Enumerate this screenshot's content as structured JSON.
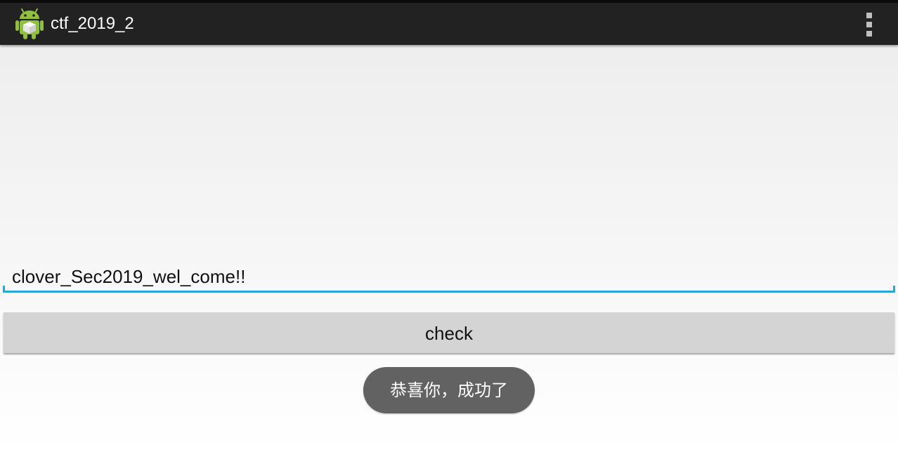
{
  "action_bar": {
    "title": "ctf_2019_2",
    "app_icon": "android-robot-icon",
    "overflow_icon": "overflow-menu-icon"
  },
  "input": {
    "value": "clover_Sec2019_wel_come!!",
    "accent_color": "#2aa6d6"
  },
  "check_button": {
    "label": "check"
  },
  "toast": {
    "message": "恭喜你，成功了"
  },
  "colors": {
    "action_bar_bg": "#222222",
    "button_bg": "#d4d4d4",
    "toast_bg": "#626262"
  }
}
